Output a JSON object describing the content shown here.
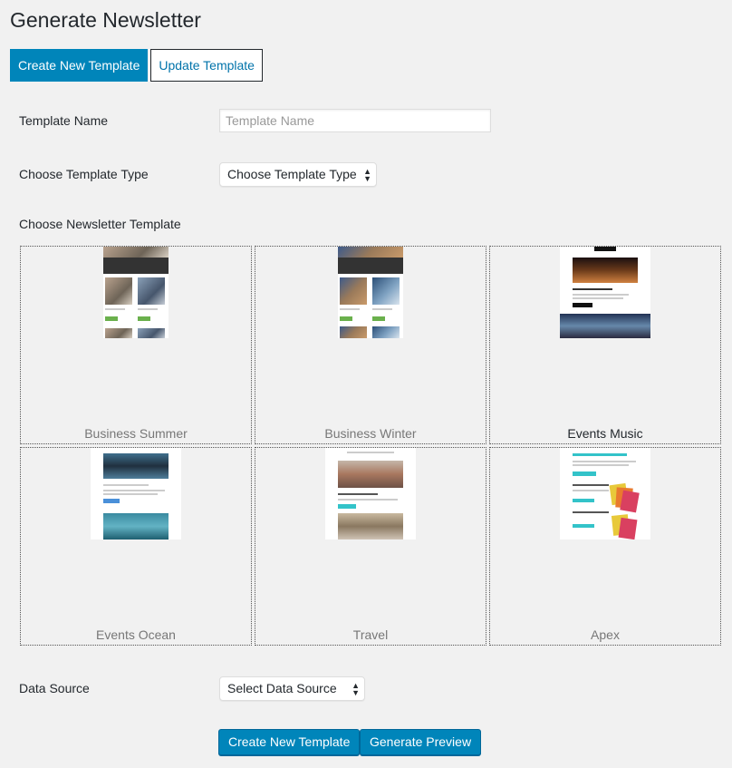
{
  "page": {
    "title": "Generate Newsletter"
  },
  "tabs": [
    {
      "label": "Create New Template",
      "active": true
    },
    {
      "label": "Update Template",
      "active": false
    }
  ],
  "form": {
    "template_name": {
      "label": "Template Name",
      "placeholder": "Template Name",
      "value": ""
    },
    "template_type": {
      "label": "Choose Template Type",
      "value": "Choose Template Type"
    },
    "newsletter_template": {
      "label": "Choose Newsletter Template"
    },
    "data_source": {
      "label": "Data Source",
      "value": "Select Data Source"
    }
  },
  "templates": [
    {
      "name": "Business Summer",
      "selected": false
    },
    {
      "name": "Business Winter",
      "selected": false
    },
    {
      "name": "Events Music",
      "selected": true
    },
    {
      "name": "Events Ocean",
      "selected": false
    },
    {
      "name": "Travel",
      "selected": false
    },
    {
      "name": "Apex",
      "selected": false
    }
  ],
  "buttons": {
    "create": "Create New Template",
    "preview": "Generate Preview"
  },
  "colors": {
    "primary": "#0085ba",
    "link": "#0073aa",
    "background": "#f1f1f1"
  }
}
